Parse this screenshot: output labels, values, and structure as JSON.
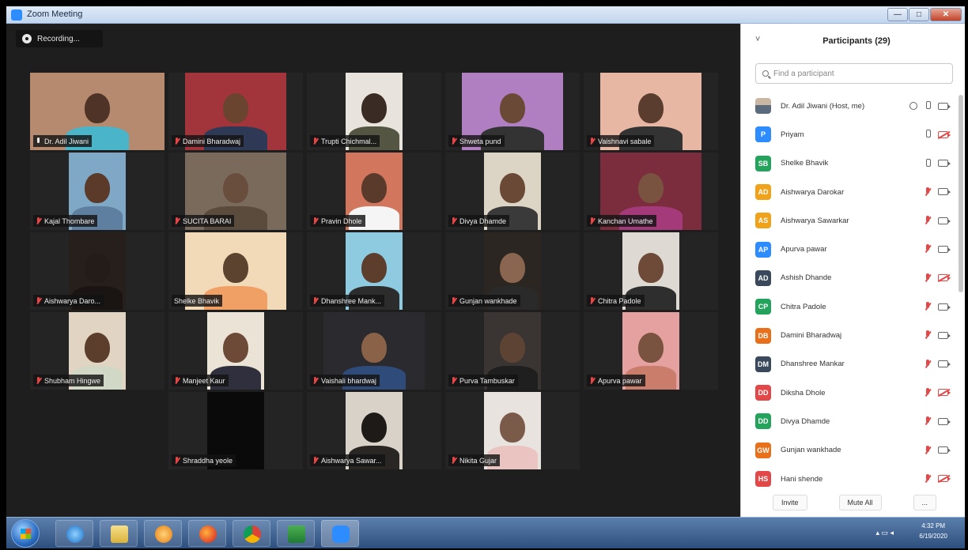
{
  "window": {
    "title": "Zoom Meeting",
    "buttons": {
      "minimize": "—",
      "maximize": "□",
      "close": "✕"
    }
  },
  "recording": {
    "label": "Recording..."
  },
  "tiles": [
    {
      "name": "Dr. Adil Jiwani",
      "active": true,
      "mic": "on"
    },
    {
      "name": "Damini Bharadwaj",
      "mic": "muted"
    },
    {
      "name": "Trupti Chichmal...",
      "mic": "muted"
    },
    {
      "name": "Shweta pund",
      "mic": "muted"
    },
    {
      "name": "Vaishnavi sabale",
      "mic": "muted"
    },
    {
      "name": "Kajal Thombare",
      "mic": "muted"
    },
    {
      "name": "SUCITA BARAI",
      "mic": "muted"
    },
    {
      "name": "Pravin Dhole",
      "mic": "muted"
    },
    {
      "name": "Divya Dhamde",
      "mic": "muted"
    },
    {
      "name": "Kanchan Umathe",
      "mic": "muted"
    },
    {
      "name": "Aishwarya  Daro...",
      "mic": "muted"
    },
    {
      "name": "Shelke Bhavik",
      "mic": "none"
    },
    {
      "name": "Dhanshree Mank...",
      "mic": "muted"
    },
    {
      "name": "Gunjan wankhade",
      "mic": "muted"
    },
    {
      "name": "Chitra  Padole",
      "mic": "muted"
    },
    {
      "name": "Shubham Hingwe",
      "mic": "muted"
    },
    {
      "name": "Manjeet Kaur",
      "mic": "muted"
    },
    {
      "name": "Vaishali bhardwaj",
      "mic": "muted"
    },
    {
      "name": "Purva Tambuskar",
      "mic": "muted"
    },
    {
      "name": "Apurva pawar",
      "mic": "muted"
    },
    {
      "name": "Shraddha yeole",
      "mic": "muted"
    },
    {
      "name": "Aishwarya Sawar...",
      "mic": "muted"
    },
    {
      "name": "Nikita Gujar",
      "mic": "muted"
    }
  ],
  "participants_panel": {
    "collapse_label": "˅",
    "title": "Participants (29)",
    "search_placeholder": "Find a participant",
    "list": [
      {
        "initials": "",
        "name": "Dr. Adil Jiwani (Host, me)",
        "color": "#7a6a5c",
        "photo": true,
        "mic": "on",
        "video": "on",
        "host": true
      },
      {
        "initials": "P",
        "name": "Priyam",
        "color": "#2d8cff",
        "mic": "on",
        "video": "off"
      },
      {
        "initials": "SB",
        "name": "Shelke Bhavik",
        "color": "#23a35b",
        "mic": "on",
        "video": "on"
      },
      {
        "initials": "AD",
        "name": "Aishwarya  Darokar",
        "color": "#f0a21b",
        "mic": "muted",
        "video": "on"
      },
      {
        "initials": "AS",
        "name": "Aishwarya Sawarkar",
        "color": "#f0a21b",
        "mic": "muted",
        "video": "on"
      },
      {
        "initials": "AP",
        "name": "Apurva pawar",
        "color": "#2d8cff",
        "mic": "muted",
        "video": "on"
      },
      {
        "initials": "AD",
        "name": "Ashish Dhande",
        "color": "#3a4a5c",
        "mic": "muted",
        "video": "off"
      },
      {
        "initials": "CP",
        "name": "Chitra  Padole",
        "color": "#23a35b",
        "mic": "muted",
        "video": "on"
      },
      {
        "initials": "DB",
        "name": "Damini Bharadwaj",
        "color": "#e8701a",
        "mic": "muted",
        "video": "on"
      },
      {
        "initials": "DM",
        "name": "Dhanshree Mankar",
        "color": "#3a4a5c",
        "mic": "muted",
        "video": "on"
      },
      {
        "initials": "DD",
        "name": "Diksha Dhole",
        "color": "#e24848",
        "mic": "muted",
        "video": "off"
      },
      {
        "initials": "DD",
        "name": "Divya Dhamde",
        "color": "#23a35b",
        "mic": "muted",
        "video": "on"
      },
      {
        "initials": "GW",
        "name": "Gunjan wankhade",
        "color": "#e8701a",
        "mic": "muted",
        "video": "on"
      },
      {
        "initials": "HS",
        "name": "Hani shende",
        "color": "#e24848",
        "mic": "muted",
        "video": "off"
      }
    ],
    "footer": {
      "invite": "Invite",
      "mute_all": "Mute All",
      "more": "..."
    }
  },
  "taskbar": {
    "apps": [
      "windows-explorer",
      "internet-explorer",
      "file-manager",
      "media-player",
      "firefox",
      "chrome",
      "excel",
      "zoom"
    ],
    "tray_icons": "▴ ▭ ◂",
    "time": "4:32 PM",
    "date": "6/19/2020"
  }
}
